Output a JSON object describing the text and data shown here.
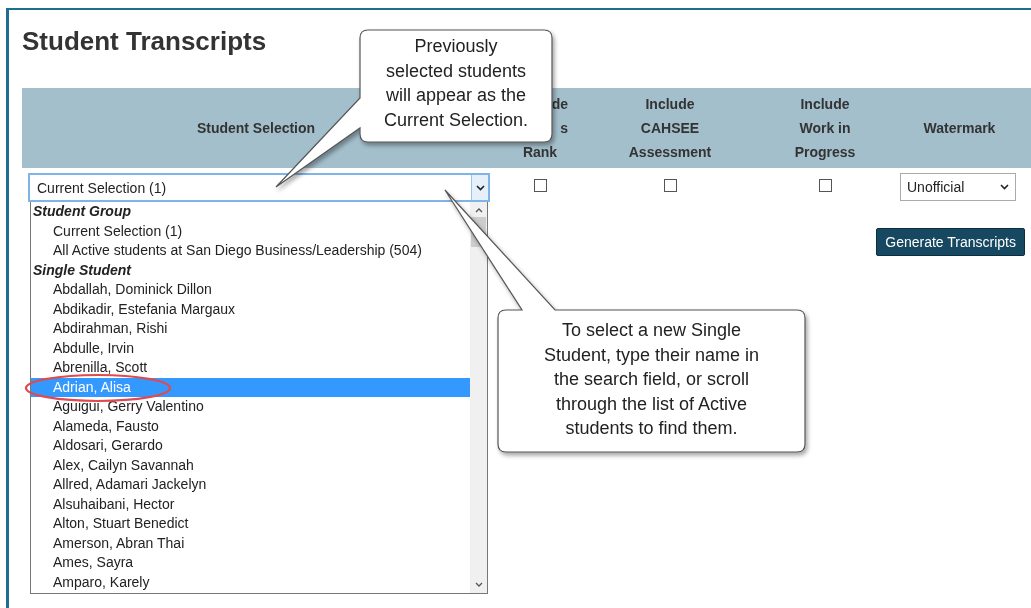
{
  "title": "Student Transcripts",
  "columns": [
    {
      "kind": "full",
      "lines": [
        "Student Selection"
      ]
    },
    {
      "kind": "cut",
      "lines": [
        "de",
        "s",
        "Rank"
      ]
    },
    {
      "kind": "full",
      "lines": [
        "Include",
        "CAHSEE",
        "Assessment"
      ]
    },
    {
      "kind": "full",
      "lines": [
        "Include",
        "Work in",
        "Progress"
      ]
    },
    {
      "kind": "full",
      "lines": [
        "Watermark"
      ]
    }
  ],
  "student_select": {
    "value": "Current Selection (1)",
    "expanded": true
  },
  "checkboxes": [
    {
      "checked": false
    },
    {
      "checked": false
    },
    {
      "checked": false
    }
  ],
  "watermark_select": {
    "value": "Unofficial"
  },
  "generate_button": "Generate Transcripts",
  "option_groups": [
    {
      "label": "Student Group",
      "options": [
        {
          "text": "Current Selection (1)",
          "selected": false
        },
        {
          "text": "All Active students at San Diego Business/Leadership (504)",
          "selected": false
        }
      ]
    },
    {
      "label": "Single Student",
      "options": [
        {
          "text": "Abdallah, Dominick Dillon",
          "selected": false
        },
        {
          "text": "Abdikadir, Estefania Margaux",
          "selected": false
        },
        {
          "text": "Abdirahman, Rishi",
          "selected": false
        },
        {
          "text": "Abdulle, Irvin",
          "selected": false
        },
        {
          "text": "Abrenilla, Scott",
          "selected": false
        },
        {
          "text": "Adrian, Alisa",
          "selected": true
        },
        {
          "text": "Aguigui, Gerry Valentino",
          "selected": false
        },
        {
          "text": "Alameda, Fausto",
          "selected": false
        },
        {
          "text": "Aldosari, Gerardo",
          "selected": false
        },
        {
          "text": "Alex, Cailyn Savannah",
          "selected": false
        },
        {
          "text": "Allred, Adamari Jackelyn",
          "selected": false
        },
        {
          "text": "Alsuhaibani, Hector",
          "selected": false
        },
        {
          "text": "Alton, Stuart Benedict",
          "selected": false
        },
        {
          "text": "Amerson, Abran Thai",
          "selected": false
        },
        {
          "text": "Ames, Sayra",
          "selected": false
        },
        {
          "text": "Amparo, Karely",
          "selected": false
        }
      ]
    }
  ],
  "callouts": [
    {
      "lines": [
        "Previously",
        "selected students",
        "will appear as the",
        "Current Selection."
      ]
    },
    {
      "lines": [
        "To select a new Single",
        "Student, type their name in",
        "the search field, or scroll",
        "through the list of Active",
        "students to find them."
      ]
    }
  ]
}
